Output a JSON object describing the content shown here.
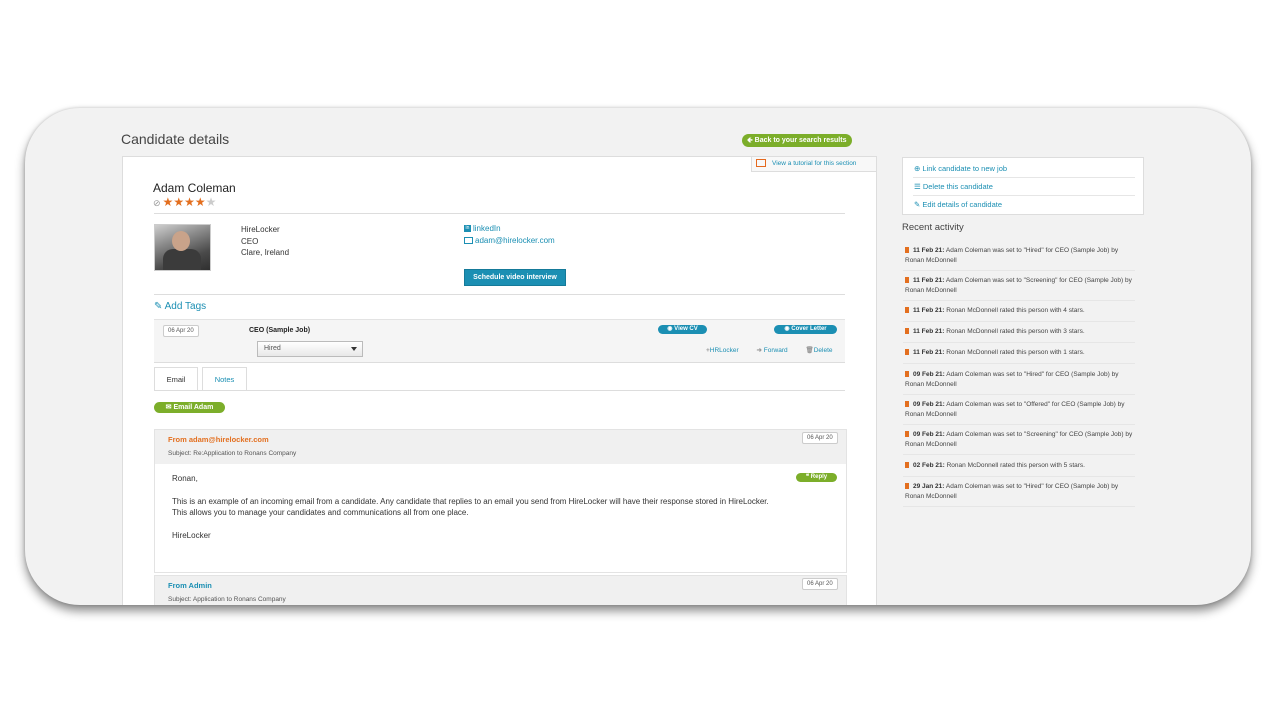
{
  "page": {
    "title": "Candidate details"
  },
  "header": {
    "back_label": "Back to your search results",
    "tutorial_label": "View a tutorial for this section"
  },
  "candidate": {
    "name": "Adam Coleman",
    "rating": 4,
    "rating_max": 5,
    "company": "HireLocker",
    "role": "CEO",
    "location": "Clare, Ireland",
    "linkedin_label": "linkedIn",
    "email": "adam@hirelocker.com",
    "schedule_label": "Schedule video interview",
    "add_tags_label": "Add Tags"
  },
  "application": {
    "date": "06 Apr 20",
    "job_title": "CEO (Sample Job)",
    "status": "Hired",
    "view_cv_label": "View CV",
    "cover_letter_label": "Cover Letter",
    "actions": {
      "hrlocker": "HRLocker",
      "forward": "Forward",
      "delete": "Delete"
    }
  },
  "tabs": [
    {
      "label": "Email"
    },
    {
      "label": "Notes"
    }
  ],
  "email_button_label": "Email Adam",
  "messages": [
    {
      "from": "From adam@hirelocker.com",
      "date": "06 Apr 20",
      "subject": "Subject: Re:Application to Ronans Company",
      "reply_label": "Reply",
      "body": {
        "greeting": "Ronan,",
        "p1": "This is an example of an incoming email from a candidate. Any candidate that replies to an email you send from HireLocker will have their response stored in HireLocker.",
        "p2": "This allows you to manage your candidates and communications all from one place.",
        "signature": "HireLocker"
      }
    },
    {
      "from": "From Admin",
      "date": "06 Apr 20",
      "subject": "Subject: Application to Ronans Company"
    }
  ],
  "sidebar": {
    "actions": [
      {
        "label": "Link candidate to new job",
        "icon": "plus-circle-icon"
      },
      {
        "label": "Delete this candidate",
        "icon": "trash-icon"
      },
      {
        "label": "Edit details of candidate",
        "icon": "pencil-icon"
      }
    ],
    "recent_title": "Recent activity",
    "activity": [
      {
        "date": "11 Feb 21:",
        "text": "Adam Coleman was set to \"Hired\" for CEO (Sample Job) by Ronan McDonnell"
      },
      {
        "date": "11 Feb 21:",
        "text": "Adam Coleman was set to \"Screening\" for CEO (Sample Job) by Ronan McDonnell"
      },
      {
        "date": "11 Feb 21:",
        "text": "Ronan McDonnell rated this person with 4 stars."
      },
      {
        "date": "11 Feb 21:",
        "text": "Ronan McDonnell rated this person with 3 stars."
      },
      {
        "date": "11 Feb 21:",
        "text": "Ronan McDonnell rated this person with 1 stars."
      },
      {
        "date": "09 Feb 21:",
        "text": "Adam Coleman was set to \"Hired\" for CEO (Sample Job) by Ronan McDonnell"
      },
      {
        "date": "09 Feb 21:",
        "text": "Adam Coleman was set to \"Offered\" for CEO (Sample Job) by Ronan McDonnell"
      },
      {
        "date": "09 Feb 21:",
        "text": "Adam Coleman was set to \"Screening\" for CEO (Sample Job) by Ronan McDonnell"
      },
      {
        "date": "02 Feb 21:",
        "text": "Ronan McDonnell rated this person with 5 stars."
      },
      {
        "date": "29 Jan 21:",
        "text": "Adam Coleman was set to \"Hired\" for CEO (Sample Job) by Ronan McDonnell"
      }
    ]
  },
  "colors": {
    "accent_blue": "#1b8fb3",
    "accent_green": "#7cae2a",
    "accent_orange": "#e36f1f"
  }
}
